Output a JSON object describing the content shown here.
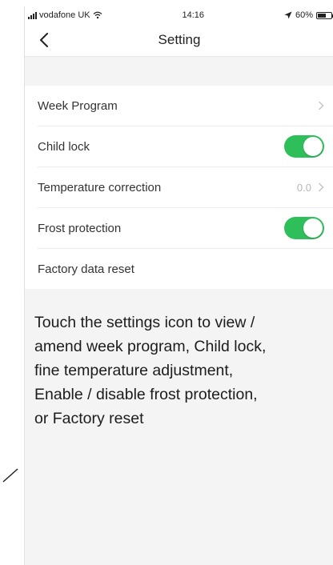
{
  "status_bar": {
    "carrier": "vodafone UK",
    "time": "14:16",
    "battery": "60%",
    "battery_level": 0.6
  },
  "header": {
    "title": "Setting"
  },
  "settings": {
    "week_program": {
      "label": "Week Program"
    },
    "child_lock": {
      "label": "Child lock",
      "enabled": true
    },
    "temperature_correction": {
      "label": "Temperature correction",
      "value": "0.0"
    },
    "frost_protection": {
      "label": "Frost protection",
      "enabled": true
    },
    "factory_reset": {
      "label": "Factory data reset"
    }
  },
  "annotation": {
    "lines": [
      "Touch the settings icon to view /",
      "amend week program, Child lock,",
      "fine temperature adjustment,",
      "Enable / disable frost protection,",
      "or Factory reset"
    ]
  },
  "colors": {
    "toggle_on": "#2fbf5a",
    "page_bg": "#f4f4f4"
  }
}
